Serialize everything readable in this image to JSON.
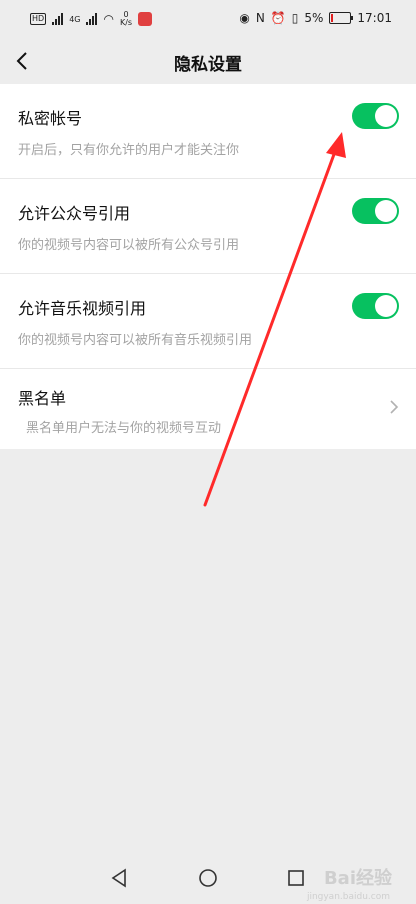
{
  "status_bar": {
    "network_label": "4G",
    "speed_value": "0",
    "speed_unit": "K/s",
    "nfc_label": "N",
    "battery": "5%",
    "time": "17:01"
  },
  "header": {
    "title": "隐私设置"
  },
  "settings": [
    {
      "label": "私密帐号",
      "desc": "开启后，只有你允许的用户才能关注你",
      "enabled": true
    },
    {
      "label": "允许公众号引用",
      "desc": "你的视频号内容可以被所有公众号引用",
      "enabled": true
    },
    {
      "label": "允许音乐视频引用",
      "desc": "你的视频号内容可以被所有音乐视频引用",
      "enabled": true
    }
  ],
  "blacklist": {
    "label": "黑名单",
    "desc": "黑名单用户无法与你的视频号互动"
  },
  "colors": {
    "toggle_on": "#07c160",
    "annotation_arrow": "#ff2a2a"
  },
  "watermark": {
    "brand": "Bai经验",
    "url": "jingyan.baidu.com"
  }
}
